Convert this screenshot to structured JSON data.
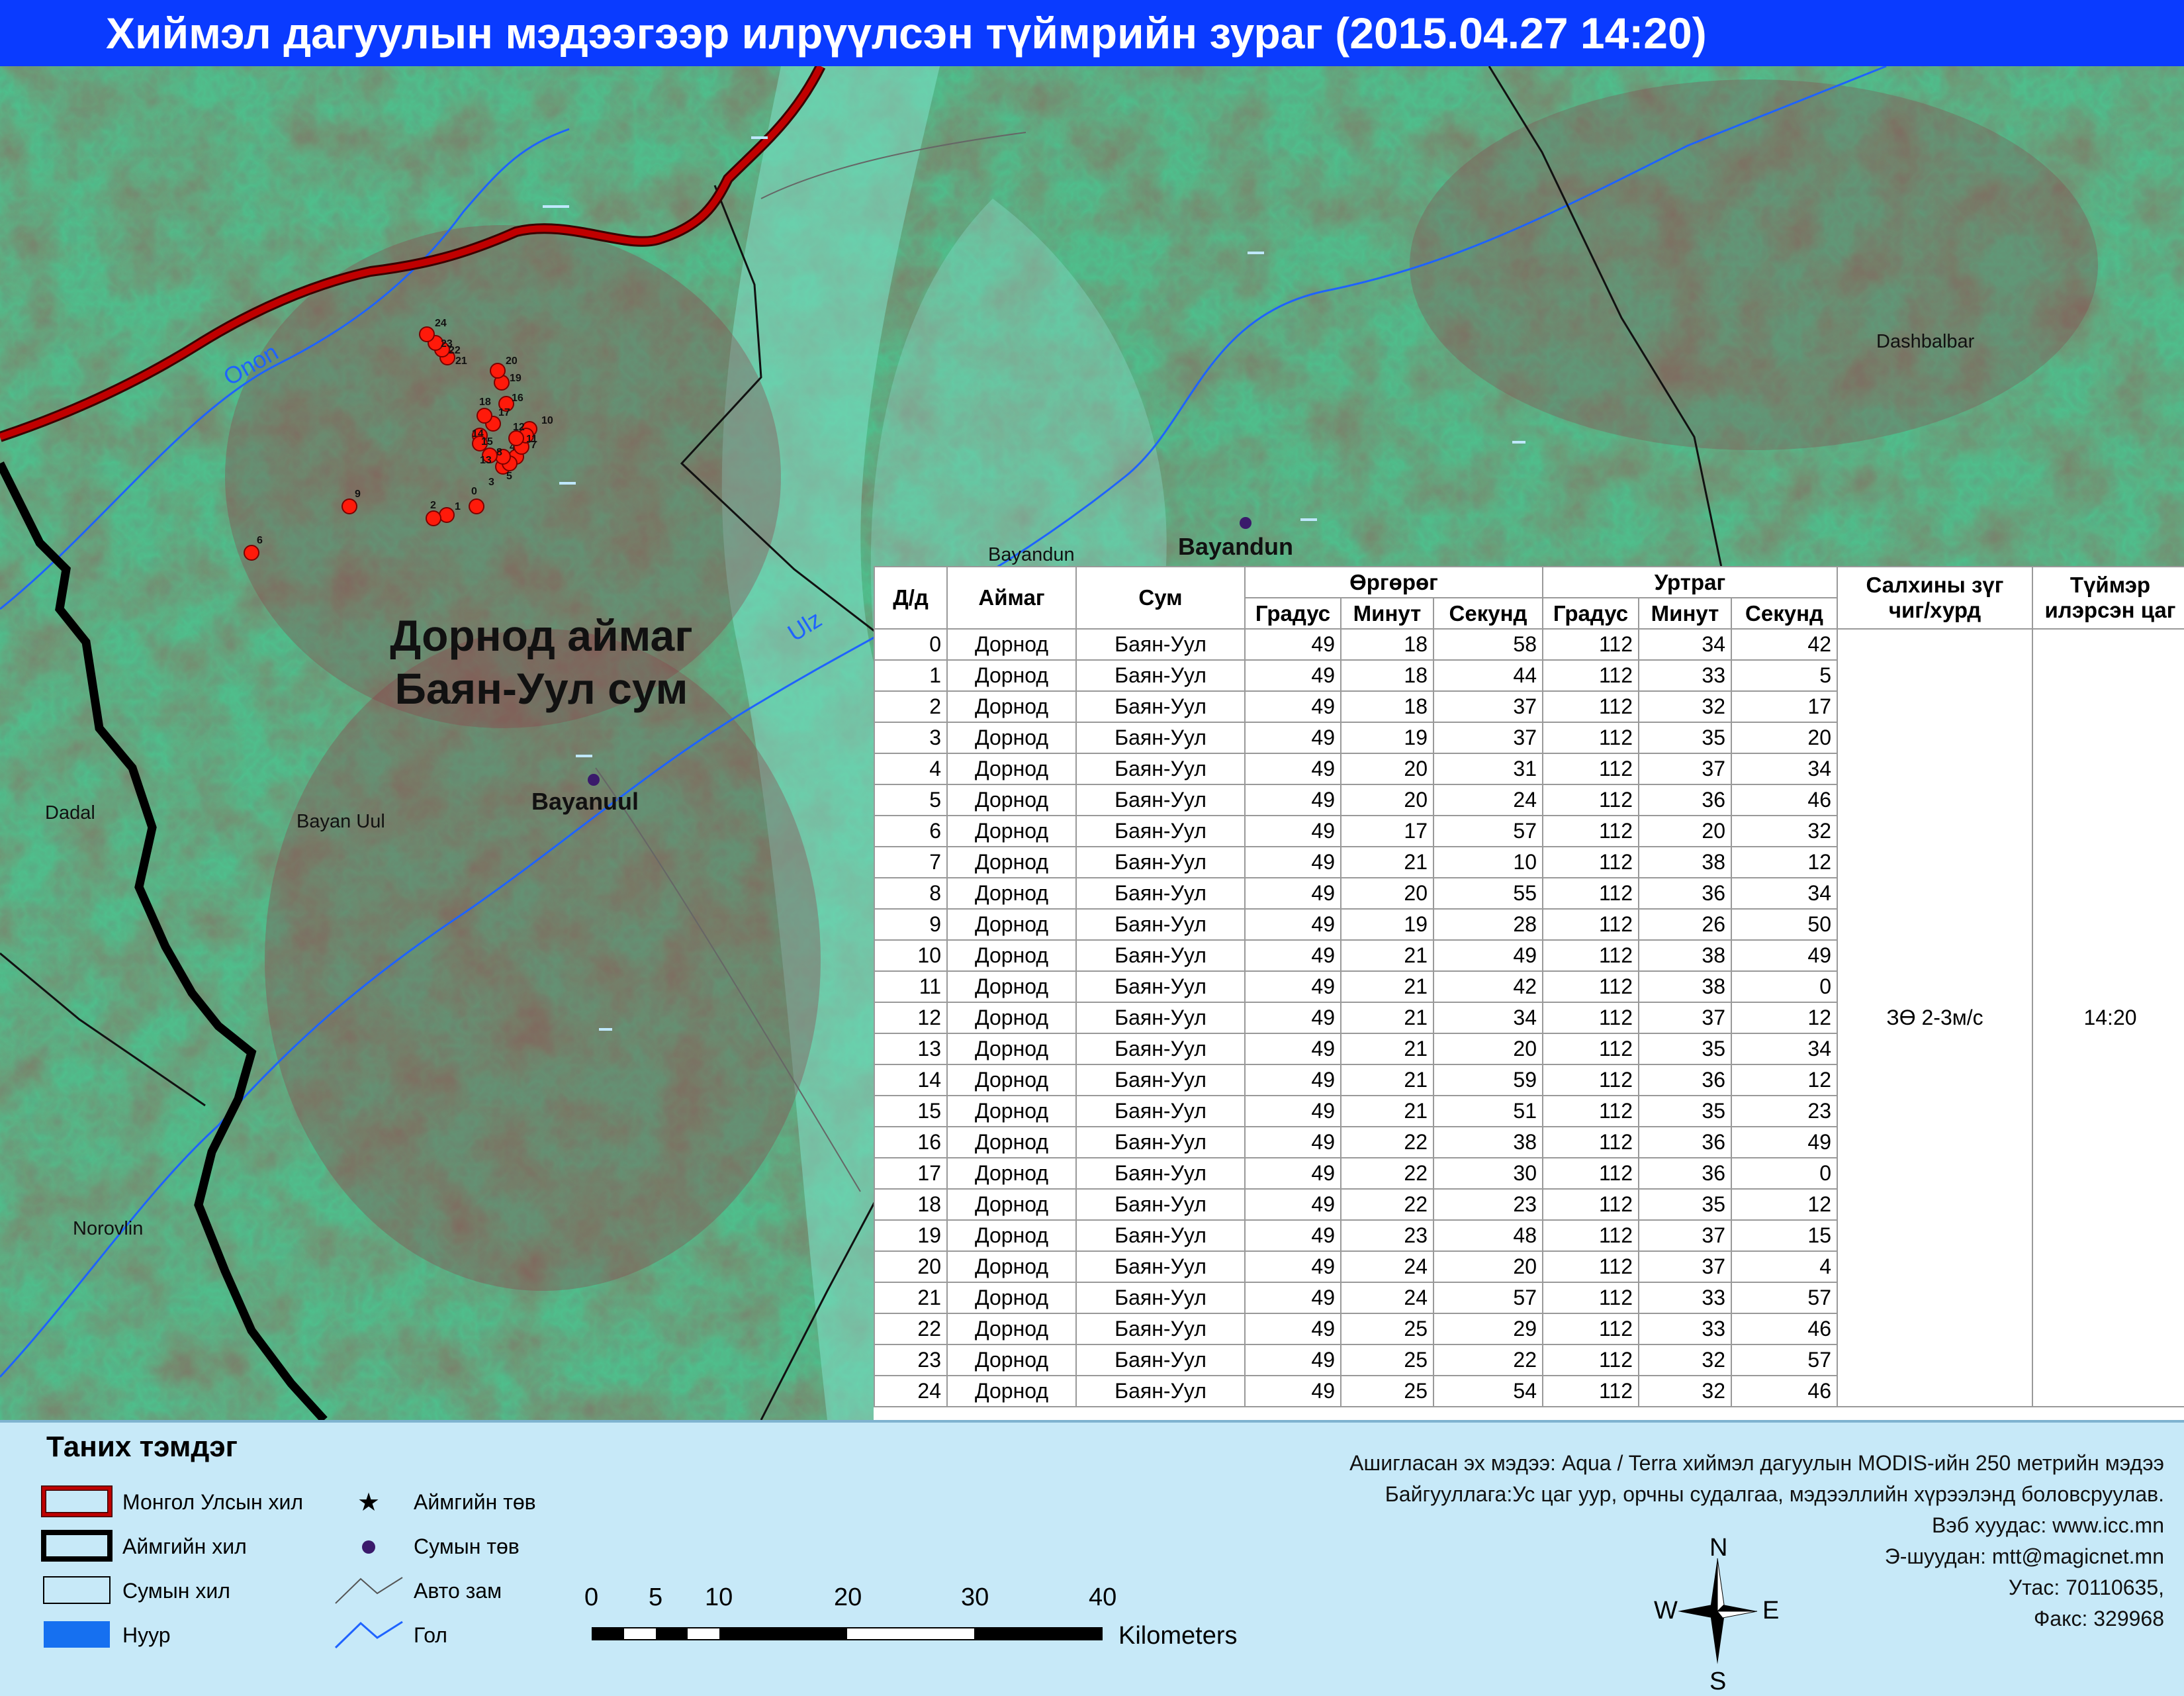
{
  "title": "Хиймэл дагуулын мэдээгээр илрүүлсэн түймрийн зураг  (2015.04.27 14:20)",
  "map": {
    "region_line1": "Дорнод аймаг",
    "region_line2": "Баян-Уул сум",
    "rivers": [
      "Onon",
      "Ulz"
    ],
    "places": {
      "dashbalbar": "Dashbalbar",
      "bayandun_small": "Bayandun",
      "bayandun": "Bayandun",
      "bayanuul": "Bayanuul",
      "bayan_uul": "Bayan Uul",
      "dadal": "Dadal",
      "norovlin": "Norovlin"
    },
    "fire_labels": [
      "0",
      "1",
      "2",
      "3",
      "4",
      "5",
      "6",
      "7",
      "8",
      "9",
      "10",
      "11",
      "12",
      "13",
      "14",
      "15",
      "16",
      "17",
      "18",
      "19",
      "20",
      "21",
      "22",
      "23",
      "24"
    ],
    "colors": {
      "fire": "#ff1a0a",
      "national_border": "#b00000",
      "aimag_border": "#000000",
      "river": "#1f63ff",
      "sum_center": "#3a1a6b"
    }
  },
  "table": {
    "headers": {
      "no": "Д/д",
      "aimag": "Аймаг",
      "sum": "Сум",
      "lat": "Өргөрөг",
      "lon": "Уртраг",
      "deg": "Градус",
      "min": "Минут",
      "sec": "Секунд",
      "wind": "Салхины зүг чиг/хурд",
      "time": "Түймэр илэрсэн цаг"
    },
    "wind_value": "ЗӨ 2-3м/с",
    "time_value": "14:20",
    "rows": [
      [
        "0",
        "Дорнод",
        "Баян-Уул",
        "49",
        "18",
        "58",
        "112",
        "34",
        "42"
      ],
      [
        "1",
        "Дорнод",
        "Баян-Уул",
        "49",
        "18",
        "44",
        "112",
        "33",
        "5"
      ],
      [
        "2",
        "Дорнод",
        "Баян-Уул",
        "49",
        "18",
        "37",
        "112",
        "32",
        "17"
      ],
      [
        "3",
        "Дорнод",
        "Баян-Уул",
        "49",
        "19",
        "37",
        "112",
        "35",
        "20"
      ],
      [
        "4",
        "Дорнод",
        "Баян-Уул",
        "49",
        "20",
        "31",
        "112",
        "37",
        "34"
      ],
      [
        "5",
        "Дорнод",
        "Баян-Уул",
        "49",
        "20",
        "24",
        "112",
        "36",
        "46"
      ],
      [
        "6",
        "Дорнод",
        "Баян-Уул",
        "49",
        "17",
        "57",
        "112",
        "20",
        "32"
      ],
      [
        "7",
        "Дорнод",
        "Баян-Уул",
        "49",
        "21",
        "10",
        "112",
        "38",
        "12"
      ],
      [
        "8",
        "Дорнод",
        "Баян-Уул",
        "49",
        "20",
        "55",
        "112",
        "36",
        "34"
      ],
      [
        "9",
        "Дорнод",
        "Баян-Уул",
        "49",
        "19",
        "28",
        "112",
        "26",
        "50"
      ],
      [
        "10",
        "Дорнод",
        "Баян-Уул",
        "49",
        "21",
        "49",
        "112",
        "38",
        "49"
      ],
      [
        "11",
        "Дорнод",
        "Баян-Уул",
        "49",
        "21",
        "42",
        "112",
        "38",
        "0"
      ],
      [
        "12",
        "Дорнод",
        "Баян-Уул",
        "49",
        "21",
        "34",
        "112",
        "37",
        "12"
      ],
      [
        "13",
        "Дорнод",
        "Баян-Уул",
        "49",
        "21",
        "20",
        "112",
        "35",
        "34"
      ],
      [
        "14",
        "Дорнод",
        "Баян-Уул",
        "49",
        "21",
        "59",
        "112",
        "36",
        "12"
      ],
      [
        "15",
        "Дорнод",
        "Баян-Уул",
        "49",
        "21",
        "51",
        "112",
        "35",
        "23"
      ],
      [
        "16",
        "Дорнод",
        "Баян-Уул",
        "49",
        "22",
        "38",
        "112",
        "36",
        "49"
      ],
      [
        "17",
        "Дорнод",
        "Баян-Уул",
        "49",
        "22",
        "30",
        "112",
        "36",
        "0"
      ],
      [
        "18",
        "Дорнод",
        "Баян-Уул",
        "49",
        "22",
        "23",
        "112",
        "35",
        "12"
      ],
      [
        "19",
        "Дорнод",
        "Баян-Уул",
        "49",
        "23",
        "48",
        "112",
        "37",
        "15"
      ],
      [
        "20",
        "Дорнод",
        "Баян-Уул",
        "49",
        "24",
        "20",
        "112",
        "37",
        "4"
      ],
      [
        "21",
        "Дорнод",
        "Баян-Уул",
        "49",
        "24",
        "57",
        "112",
        "33",
        "57"
      ],
      [
        "22",
        "Дорнод",
        "Баян-Уул",
        "49",
        "25",
        "29",
        "112",
        "33",
        "46"
      ],
      [
        "23",
        "Дорнод",
        "Баян-Уул",
        "49",
        "25",
        "22",
        "112",
        "32",
        "57"
      ],
      [
        "24",
        "Дорнод",
        "Баян-Уул",
        "49",
        "25",
        "54",
        "112",
        "32",
        "46"
      ]
    ]
  },
  "legend": {
    "title": "Таних тэмдэг",
    "items": {
      "national_border": "Монгол Улсын хил",
      "aimag_border": "Аймгийн хил",
      "sum_border": "Сумын хил",
      "lake": "Нуур",
      "aimag_center": "Аймгийн төв",
      "sum_center": "Сумын төв",
      "road": "Авто зам",
      "river": "Гол"
    },
    "source_lines": [
      "Ашигласан эх мэдээ: Aqua / Terra хиймэл дагуулын MODIS-ийн 250 метрийн мэдээ",
      "Байгууллага:Ус цаг уур, орчны судалгаа, мэдээллийн хүрээлэнд боловсруулав.",
      "Вэб хуудас: www.icc.mn",
      "Э-шуудан: mtt@magicnet.mn",
      "Утас: 70110635,",
      "Факс: 329968"
    ],
    "scale_ticks": [
      "0",
      "5",
      "10",
      "20",
      "30",
      "40"
    ],
    "scale_unit": "Kilometers",
    "compass": {
      "n": "N",
      "s": "S",
      "e": "E",
      "w": "W"
    }
  }
}
